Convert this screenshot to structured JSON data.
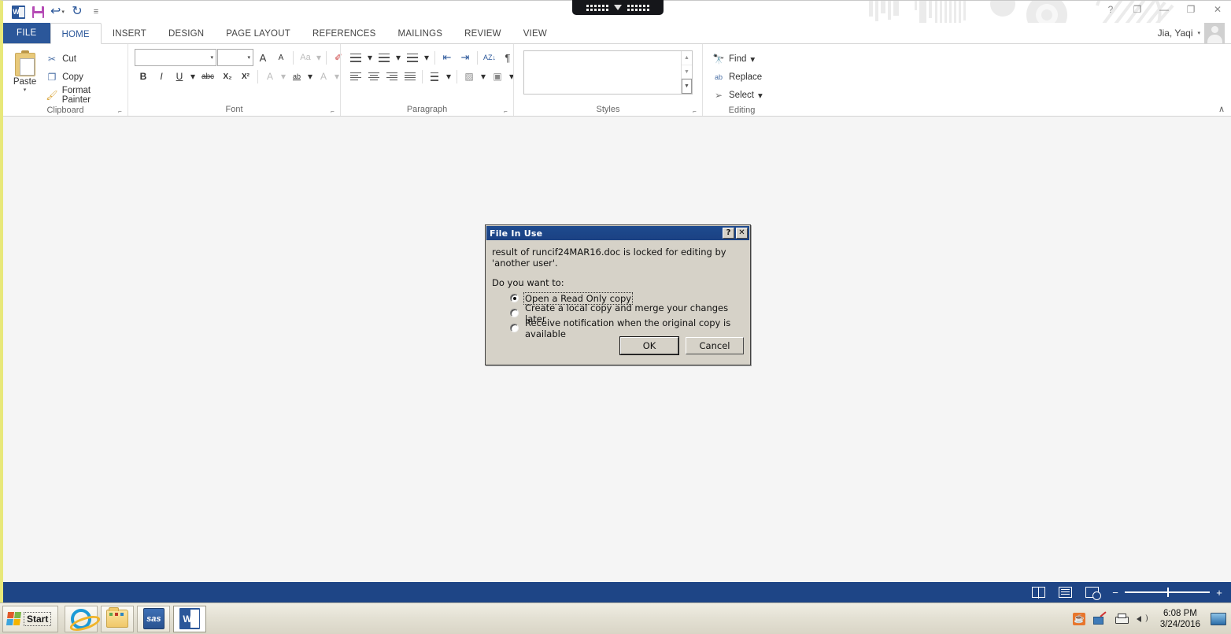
{
  "app": {
    "name": "Microsoft Word",
    "user_name": "Jia, Yaqi"
  },
  "quick_access": {
    "items": [
      {
        "name": "word-logo",
        "label": "W"
      },
      {
        "name": "save",
        "label": "Save"
      },
      {
        "name": "undo",
        "label": "↩"
      },
      {
        "name": "redo",
        "label": "↻"
      },
      {
        "name": "customize",
        "label": "≡"
      }
    ]
  },
  "window_controls": {
    "help": "?",
    "ribbon_display_options": "❐",
    "minimize": "—",
    "restore": "❐",
    "close": "✕"
  },
  "tabs": [
    {
      "label": "FILE",
      "active": false,
      "file": true
    },
    {
      "label": "HOME",
      "active": true
    },
    {
      "label": "INSERT",
      "active": false
    },
    {
      "label": "DESIGN",
      "active": false
    },
    {
      "label": "PAGE LAYOUT",
      "active": false
    },
    {
      "label": "REFERENCES",
      "active": false
    },
    {
      "label": "MAILINGS",
      "active": false
    },
    {
      "label": "REVIEW",
      "active": false
    },
    {
      "label": "VIEW",
      "active": false
    }
  ],
  "ribbon": {
    "collapse_label": "∧",
    "clipboard": {
      "group_label": "Clipboard",
      "paste_label": "Paste",
      "cut_label": "Cut",
      "copy_label": "Copy",
      "format_painter_label": "Format Painter"
    },
    "font": {
      "group_label": "Font",
      "font_name_value": "",
      "font_size_value": "",
      "grow_font": "A",
      "shrink_font": "A",
      "change_case": "Aa",
      "clear_formatting": "✐",
      "bold": "B",
      "italic": "I",
      "underline": "U",
      "strikethrough": "abc",
      "subscript": "X₂",
      "superscript": "X²",
      "text_effects": "A",
      "text_highlight": "ab",
      "font_color": "A"
    },
    "paragraph": {
      "group_label": "Paragraph",
      "bullets": "≡",
      "numbering": "≡",
      "multilevel_list": "≡",
      "decrease_indent": "⇤",
      "increase_indent": "⇥",
      "sort": "AZ↓",
      "show_marks": "¶",
      "align_left": "align left",
      "align_center": "align center",
      "align_right": "align right",
      "justify": "justify",
      "line_spacing": "line spacing",
      "shading": "shading",
      "borders": "borders"
    },
    "styles": {
      "group_label": "Styles",
      "scroll_up": "▲",
      "scroll_down": "▼",
      "more": "▼"
    },
    "editing": {
      "group_label": "Editing",
      "find_label": "Find",
      "replace_label": "Replace",
      "select_label": "Select"
    },
    "dialog_launcher": "⤡"
  },
  "status_bar": {
    "view_read_mode": "Read Mode",
    "view_print_layout": "Print Layout",
    "view_web_layout": "Web Layout",
    "zoom_out": "−",
    "zoom_in": "+"
  },
  "dialog": {
    "title": "File In Use",
    "help_button": "?",
    "close_button": "✕",
    "message": "result of runcif24MAR16.doc is locked for editing by 'another user'.",
    "prompt": "Do you want to:",
    "options": [
      {
        "label": "Open a Read Only copy",
        "selected": true,
        "focused": true
      },
      {
        "label": "Create a local copy and merge your changes later",
        "selected": false,
        "focused": false
      },
      {
        "label": "Receive notification when the original copy is available",
        "selected": false,
        "focused": false
      }
    ],
    "ok_label": "OK",
    "cancel_label": "Cancel"
  },
  "taskbar": {
    "start_label": "Start",
    "apps": [
      {
        "name": "internet-explorer",
        "label": "Internet Explorer",
        "active": false
      },
      {
        "name": "file-explorer",
        "label": "Windows Explorer",
        "active": false
      },
      {
        "name": "sas",
        "label": "sas",
        "active": false
      },
      {
        "name": "word",
        "label": "W",
        "active": true
      }
    ],
    "tray": [
      {
        "name": "java",
        "label": "Java"
      },
      {
        "name": "network",
        "label": "Network"
      },
      {
        "name": "printer",
        "label": "Printer"
      },
      {
        "name": "volume",
        "label": "Volume"
      }
    ],
    "time": "6:08 PM",
    "date": "3/24/2016"
  },
  "colors": {
    "word_blue": "#2b579a",
    "status_blue": "#1e4586",
    "dialog_title_blue": "#1e4b8f",
    "dialog_face": "#d6d2c8",
    "workspace": "#f5f5f5",
    "accent_yellow": "#e8e87a"
  }
}
